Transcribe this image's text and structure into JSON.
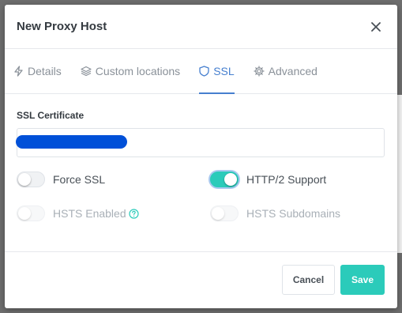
{
  "modal": {
    "title": "New Proxy Host"
  },
  "tabs": [
    {
      "label": "Details",
      "icon": "lightning-icon",
      "active": false
    },
    {
      "label": "Custom locations",
      "icon": "layers-icon",
      "active": false
    },
    {
      "label": "SSL",
      "icon": "shield-icon",
      "active": true
    },
    {
      "label": "Advanced",
      "icon": "gear-icon",
      "active": false
    }
  ],
  "ssl": {
    "certificate_label": "SSL Certificate",
    "options": {
      "force_ssl": {
        "label": "Force SSL",
        "enabled": false,
        "disabled": false
      },
      "http2": {
        "label": "HTTP/2 Support",
        "enabled": true,
        "disabled": false
      },
      "hsts": {
        "label": "HSTS Enabled",
        "enabled": false,
        "disabled": true
      },
      "hsts_subdomains": {
        "label": "HSTS Subdomains",
        "enabled": false,
        "disabled": true
      }
    }
  },
  "footer": {
    "cancel_label": "Cancel",
    "save_label": "Save"
  },
  "colors": {
    "accent": "#467fcf",
    "teal": "#2bcbba",
    "redaction": "#0050d8"
  }
}
